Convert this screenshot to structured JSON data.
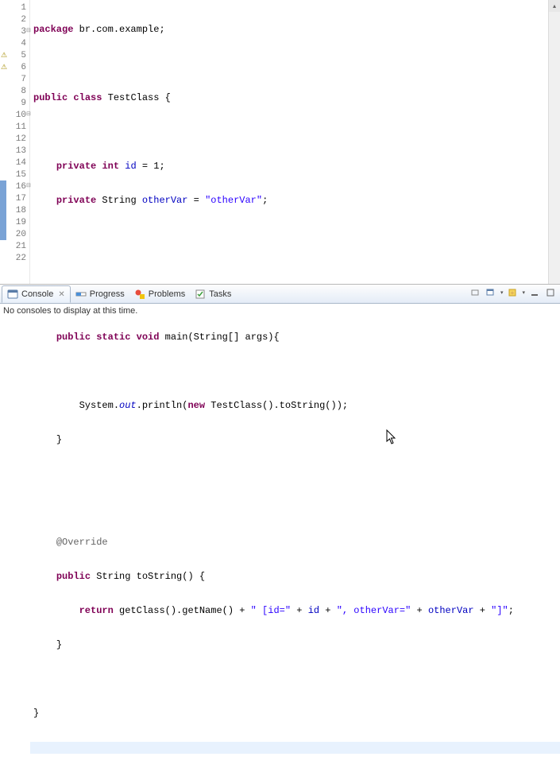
{
  "editor": {
    "lines": [
      {
        "n": "1"
      },
      {
        "n": "2"
      },
      {
        "n": "3",
        "fold": "⊟"
      },
      {
        "n": "4"
      },
      {
        "n": "5",
        "warn": "⚠"
      },
      {
        "n": "6",
        "warn": "⚠"
      },
      {
        "n": "7"
      },
      {
        "n": "8"
      },
      {
        "n": "9"
      },
      {
        "n": "10",
        "fold": "⊟"
      },
      {
        "n": "11"
      },
      {
        "n": "12"
      },
      {
        "n": "13"
      },
      {
        "n": "14"
      },
      {
        "n": "15"
      },
      {
        "n": "16",
        "fold": "⊟",
        "marker": true
      },
      {
        "n": "17",
        "marker": true
      },
      {
        "n": "18",
        "marker": true
      },
      {
        "n": "19",
        "marker": true
      },
      {
        "n": "20",
        "marker": true
      },
      {
        "n": "21"
      },
      {
        "n": "22"
      }
    ],
    "code": {
      "l1": {
        "kw1": "package",
        "t1": " br.com.example;"
      },
      "l3": {
        "kw1": "public",
        "kw2": "class",
        "t1": " TestClass {"
      },
      "l5": {
        "kw1": "private",
        "kw2": "int",
        "f1": "id",
        "t1": " = 1;"
      },
      "l6": {
        "kw1": "private",
        "t1": " String ",
        "f1": "otherVar",
        "t2": " = ",
        "s1": "\"otherVar\"",
        "t3": ";"
      },
      "l10": {
        "kw1": "public",
        "kw2": "static",
        "kw3": "void",
        "t1": " main(String[] args){"
      },
      "l12": {
        "t1": "System.",
        "sf1": "out",
        "t2": ".println(",
        "kw1": "new",
        "t3": " TestClass().toString());"
      },
      "l13": {
        "t1": "}"
      },
      "l16": {
        "a1": "@Override"
      },
      "l17": {
        "kw1": "public",
        "t1": " String toString() {"
      },
      "l18": {
        "kw1": "return",
        "t1": " getClass().getName() + ",
        "s1": "\" [id=\"",
        "t2": " + ",
        "f1": "id",
        "t3": " + ",
        "s2": "\", otherVar=\"",
        "t4": " + ",
        "f2": "otherVar",
        "t5": " + ",
        "s3": "\"]\"",
        "t6": ";"
      },
      "l19": {
        "t1": "}"
      },
      "l21": {
        "t1": "}"
      }
    }
  },
  "tabs": {
    "console": "Console",
    "progress": "Progress",
    "problems": "Problems",
    "tasks": "Tasks"
  },
  "console_msg": "No consoles to display at this time.",
  "icons": {
    "scroll_up": "▴",
    "close_x": "✕",
    "dropdown": "▾"
  }
}
